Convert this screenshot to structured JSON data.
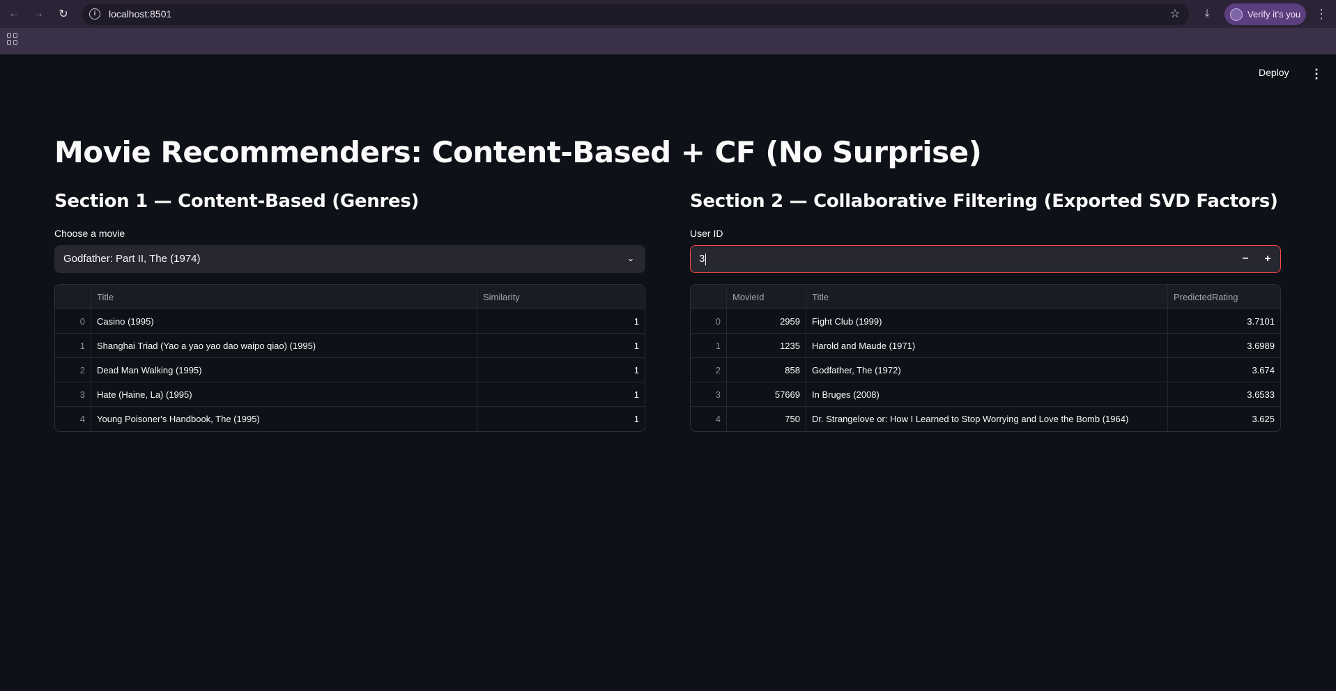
{
  "browser": {
    "url": "localhost:8501",
    "verify_label": "Verify it's you"
  },
  "app": {
    "deploy_label": "Deploy",
    "title": "Movie Recommenders: Content-Based + CF (No Surprise)"
  },
  "section1": {
    "title": "Section 1 — Content-Based (Genres)",
    "select_label": "Choose a movie",
    "selected_movie": "Godfather: Part II, The (1974)",
    "columns": [
      "",
      "Title",
      "Similarity"
    ],
    "rows": [
      {
        "idx": "0",
        "title": "Casino (1995)",
        "similarity": "1"
      },
      {
        "idx": "1",
        "title": "Shanghai Triad (Yao a yao yao dao waipo qiao) (1995)",
        "similarity": "1"
      },
      {
        "idx": "2",
        "title": "Dead Man Walking (1995)",
        "similarity": "1"
      },
      {
        "idx": "3",
        "title": "Hate (Haine, La) (1995)",
        "similarity": "1"
      },
      {
        "idx": "4",
        "title": "Young Poisoner's Handbook, The (1995)",
        "similarity": "1"
      }
    ]
  },
  "section2": {
    "title": "Section 2 — Collaborative Filtering (Exported SVD Factors)",
    "input_label": "User ID",
    "user_id": "3",
    "minus_label": "−",
    "plus_label": "+",
    "columns": [
      "",
      "MovieId",
      "Title",
      "PredictedRating"
    ],
    "rows": [
      {
        "idx": "0",
        "movieId": "2959",
        "title": "Fight Club (1999)",
        "rating": "3.7101"
      },
      {
        "idx": "1",
        "movieId": "1235",
        "title": "Harold and Maude (1971)",
        "rating": "3.6989"
      },
      {
        "idx": "2",
        "movieId": "858",
        "title": "Godfather, The (1972)",
        "rating": "3.674"
      },
      {
        "idx": "3",
        "movieId": "57669",
        "title": "In Bruges (2008)",
        "rating": "3.6533"
      },
      {
        "idx": "4",
        "movieId": "750",
        "title": "Dr. Strangelove or: How I Learned to Stop Worrying and Love the Bomb (1964)",
        "rating": "3.625"
      }
    ]
  },
  "colors": {
    "background": "#0e1117",
    "input_bg": "#262730",
    "focus_border": "#ff4b4b"
  }
}
